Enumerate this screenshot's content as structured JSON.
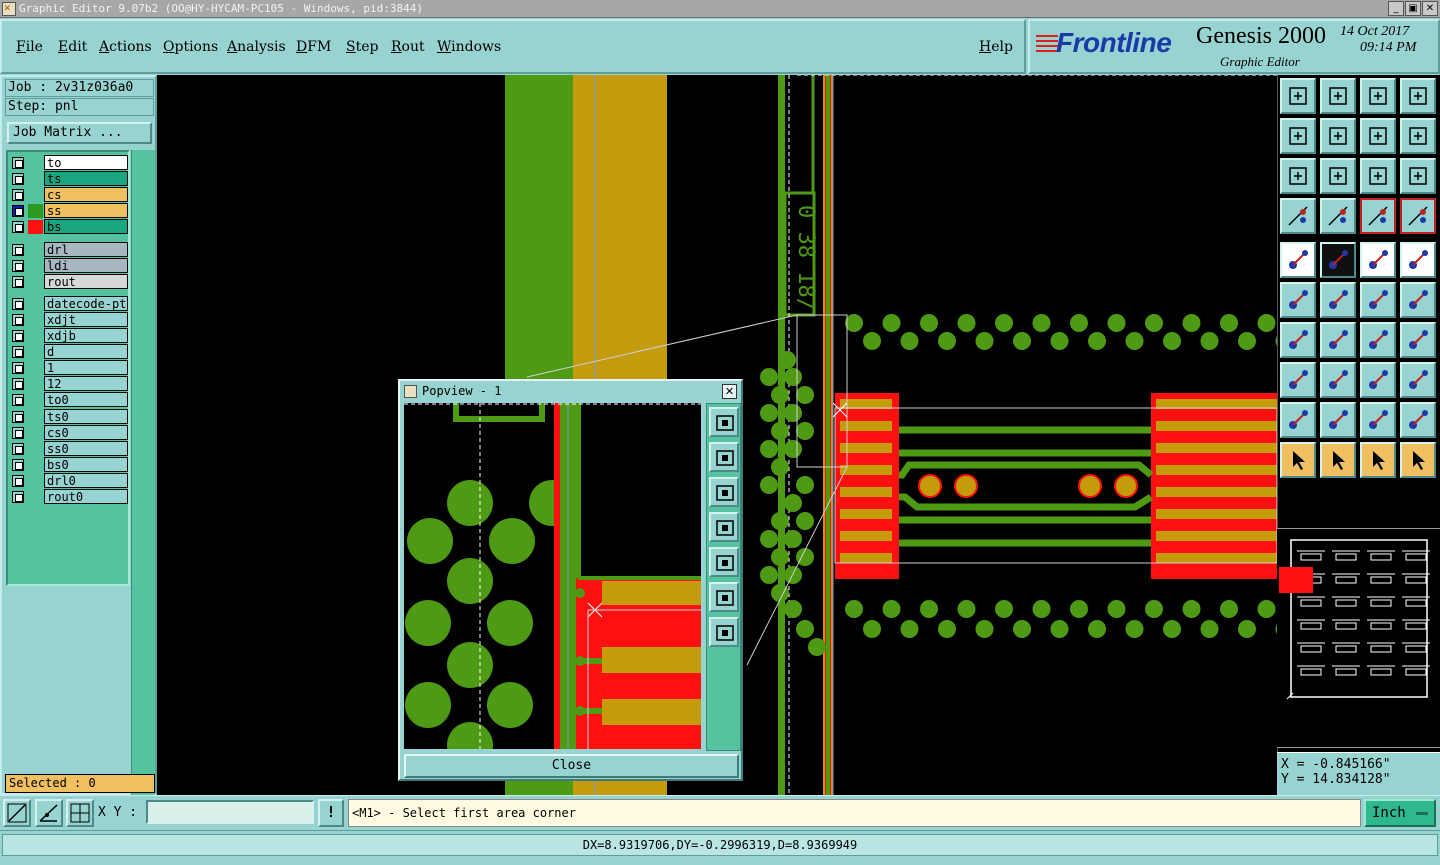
{
  "window": {
    "title": "Graphic Editor 9.07b2 (OO@HY-HYCAM-PC105 - Windows, pid:3844)",
    "minimize_label": "_",
    "maximize_label": "▣",
    "close_label": "✕"
  },
  "menu": {
    "file": "File",
    "edit": "Edit",
    "actions": "Actions",
    "options": "Options",
    "analysis": "Analysis",
    "dfm": "DFM",
    "step": "Step",
    "rout": "Rout",
    "windows": "Windows",
    "help": "Help"
  },
  "brand": {
    "logo": "Frontline",
    "product": "Genesis 2000",
    "subtitle": "Graphic Editor",
    "date": "14 Oct 2017",
    "time": "09:14 PM"
  },
  "job": {
    "job_line": "Job : 2v31z036a0",
    "step_line": "Step: pnl",
    "job_matrix_button": "Job Matrix ..."
  },
  "layers": [
    {
      "name": "to",
      "style": "white",
      "swatch": ""
    },
    {
      "name": "ts",
      "style": "green",
      "swatch": ""
    },
    {
      "name": "cs",
      "style": "orange",
      "swatch": ""
    },
    {
      "name": "ss",
      "style": "orange",
      "swatch": "#2a9a20",
      "work": true
    },
    {
      "name": "bs",
      "style": "green",
      "swatch": "#ff1010"
    },
    {
      "name": "drl",
      "style": "gray",
      "swatch": ""
    },
    {
      "name": "ldi",
      "style": "gray",
      "swatch": ""
    },
    {
      "name": "rout",
      "style": "lgray",
      "swatch": ""
    },
    {
      "name": "datecode-ptc",
      "style": "cyan",
      "swatch": ""
    },
    {
      "name": "xdjt",
      "style": "cyan",
      "swatch": ""
    },
    {
      "name": "xdjb",
      "style": "cyan",
      "swatch": ""
    },
    {
      "name": "d",
      "style": "cyan",
      "swatch": ""
    },
    {
      "name": "1",
      "style": "cyan",
      "swatch": ""
    },
    {
      "name": "12",
      "style": "cyan",
      "swatch": ""
    },
    {
      "name": "to0",
      "style": "cyan",
      "swatch": ""
    },
    {
      "name": "ts0",
      "style": "cyan",
      "swatch": ""
    },
    {
      "name": "cs0",
      "style": "cyan",
      "swatch": ""
    },
    {
      "name": "ss0",
      "style": "cyan",
      "swatch": ""
    },
    {
      "name": "bs0",
      "style": "cyan",
      "swatch": ""
    },
    {
      "name": "drl0",
      "style": "cyan",
      "swatch": ""
    },
    {
      "name": "rout0",
      "style": "cyan",
      "swatch": ""
    }
  ],
  "selected": "Selected : 0",
  "canvas_text": "0 38 18/",
  "popview": {
    "title": "Popview - 1",
    "close_label": "Close"
  },
  "coords": {
    "x": "X = -0.845166\"",
    "y": "Y = 14.834128\""
  },
  "bottom": {
    "xy_label": "X Y :",
    "xy_value": "",
    "bang": "!",
    "prompt": "<M1> - Select first area corner",
    "units": "Inch"
  },
  "status": "DX=8.9319706,DY=-0.2996319,D=8.9369949",
  "colors": {
    "background": "#97d3d0",
    "canvas": "#000000",
    "trace_green": "#4f9a14",
    "copper_yellow": "#c39b0c",
    "pad_red": "#ff1010",
    "accent_orange": "#f0c060"
  },
  "toolbar_icons": [
    "zoom-home-icon",
    "fit-window-icon",
    "home-icon",
    "pan-icon",
    "move-left-icon",
    "move-right-icon",
    "redraw-icon",
    "snap-icon",
    "zoom-fit-icon",
    "zoom-center-icon",
    "scale-1-2-icon",
    "help-query-icon",
    "measure-icon",
    "grid-icon",
    "net-highlight-icon",
    "net-highlight-alt-icon",
    "pad-icon",
    "shape-icon",
    "ruler-icon",
    "pad-select-icon",
    "connect-icon",
    "delete-node-icon",
    "line-icon",
    "line-alt-icon",
    "angle-icon",
    "slash-icon",
    "arc-icon",
    "mirror-icon",
    "node-add-icon",
    "cut-line-icon",
    "dimension-icon",
    "cluster-icon",
    "surface-icon",
    "surface-alt-icon",
    "surface-arc-icon",
    "surface-x-icon",
    "pointer-icon",
    "pointer-alt-icon",
    "pointer-pick-icon",
    "pointer-path-icon"
  ]
}
